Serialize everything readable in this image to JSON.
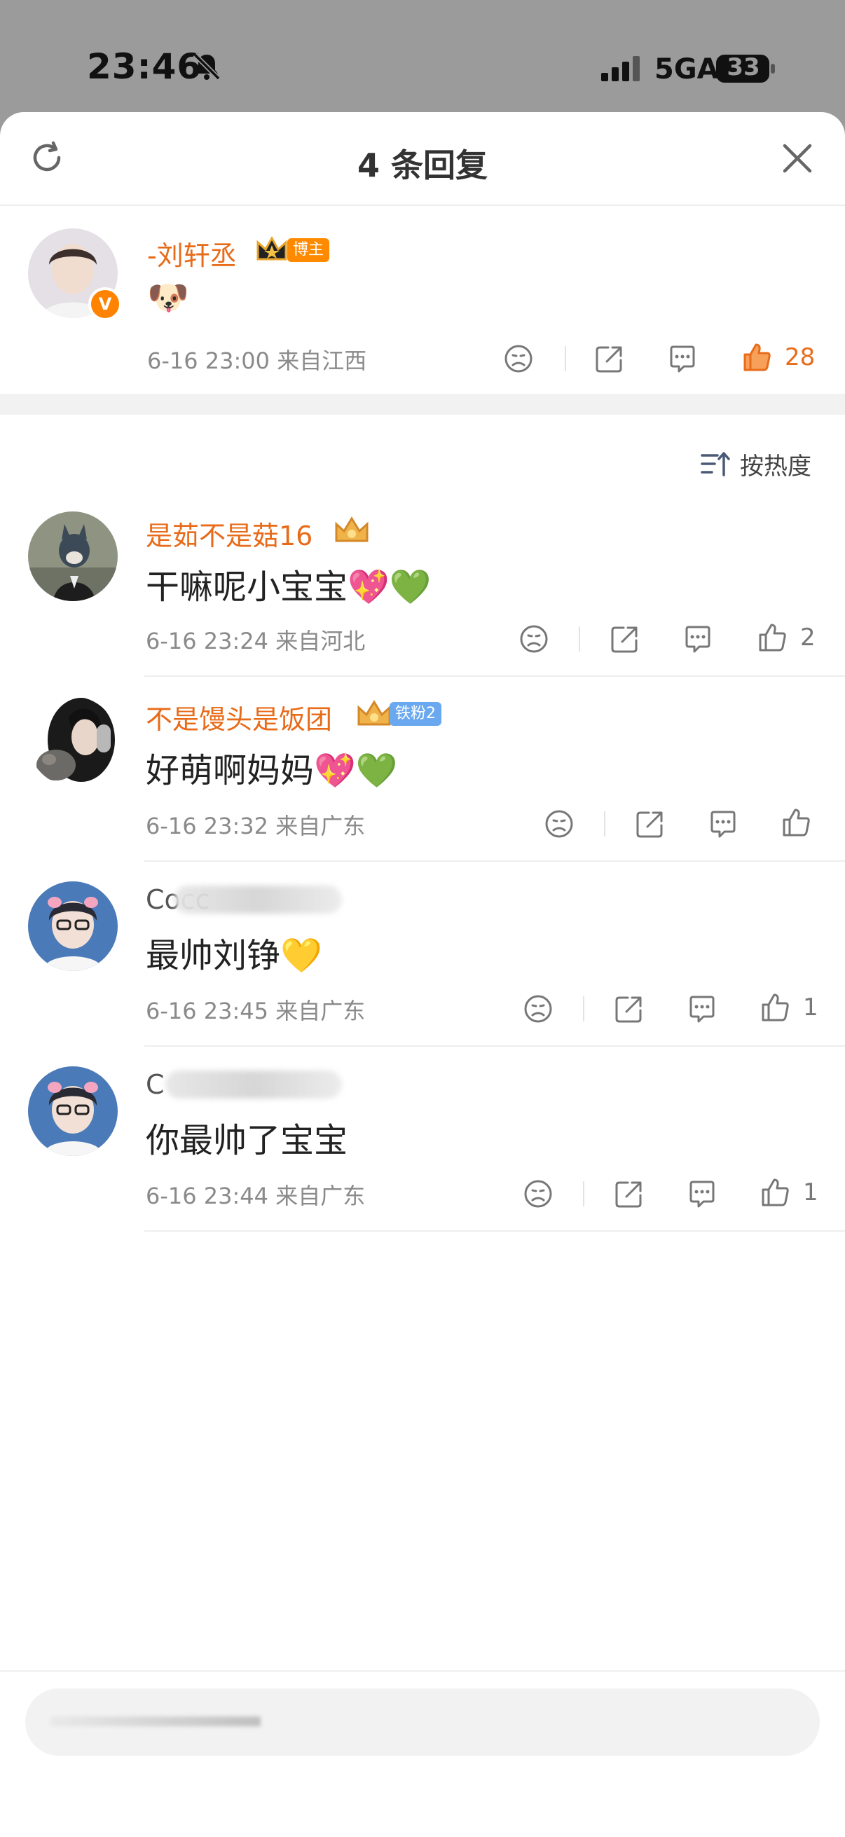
{
  "status_bar": {
    "time": "23:46",
    "network": "5GA",
    "battery": "33"
  },
  "sheet": {
    "title": "4 条回复"
  },
  "main_comment": {
    "username": "-刘轩丞",
    "badge": "博主",
    "content": "🐶",
    "time_location": "6-16 23:00  来自江西",
    "likes": "28",
    "verified_mark": "V"
  },
  "sort": {
    "label": "按热度"
  },
  "replies": [
    {
      "username": "是茹不是菇16",
      "badge": "",
      "content": "干嘛呢小宝宝💖💚",
      "time_location": "6-16 23:24  来自河北",
      "likes": "2"
    },
    {
      "username": "不是馒头是饭团",
      "badge": "铁粉2",
      "content": "好萌啊妈妈💖💚",
      "time_location": "6-16 23:32  来自广东",
      "likes": ""
    },
    {
      "username": "Cocc",
      "badge": "",
      "content": "最帅刘铮💛",
      "time_location": "6-16 23:45  来自广东",
      "likes": "1"
    },
    {
      "username": "C",
      "badge": "",
      "content": "你最帅了宝宝",
      "time_location": "6-16 23:44  来自广东",
      "likes": "1"
    }
  ],
  "colors": {
    "accent_orange": "#e86b1a",
    "badge_orange": "#ff8a00",
    "badge_blue": "#6aa9ef"
  }
}
